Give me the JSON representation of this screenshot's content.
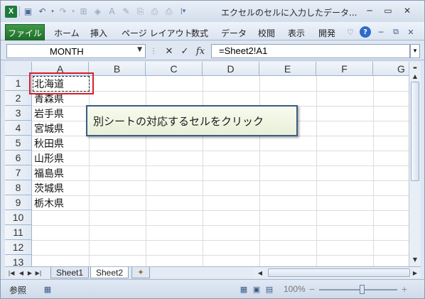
{
  "window": {
    "title": "エクセルのセルに入力したデータ...",
    "min_icon": "minimize-icon",
    "max_icon": "restore-icon",
    "close_icon": "close-icon"
  },
  "quick_access": {
    "app_icon": "X",
    "icons": [
      "save-icon",
      "undo-icon",
      "redo-icon",
      "border-icon",
      "fill-icon",
      "font-color-icon",
      "format-painter-icon",
      "paste-icon",
      "print-preview-icon",
      "print-icon",
      "customize-icon"
    ]
  },
  "ribbon": {
    "file_tab": "ファイル",
    "tabs": [
      "ホーム",
      "挿入",
      "ページ レイアウト",
      "数式",
      "データ",
      "校閲",
      "表示",
      "開発"
    ],
    "right_icons": [
      "minimize-ribbon-icon",
      "help-icon",
      "window-min-icon",
      "window-restore-icon",
      "window-close-icon"
    ]
  },
  "formula_bar": {
    "name_box": "MONTH",
    "cancel": "✕",
    "enter": "✓",
    "fx": "fx",
    "formula": "=Sheet2!A1"
  },
  "grid": {
    "columns": [
      "A",
      "B",
      "C",
      "D",
      "E",
      "F",
      "G"
    ],
    "rows": [
      "1",
      "2",
      "3",
      "4",
      "5",
      "6",
      "7",
      "8",
      "9",
      "10",
      "11",
      "12",
      "13"
    ],
    "cells": [
      "北海道",
      "青森県",
      "岩手県",
      "宮城県",
      "秋田県",
      "山形県",
      "福島県",
      "茨城県",
      "栃木県"
    ]
  },
  "callout": {
    "text": "別シートの対応するセルをクリック"
  },
  "sheet_tabs": {
    "tabs": [
      "Sheet1",
      "Sheet2"
    ],
    "active": "Sheet2",
    "new_sheet_icon": "insert-sheet-icon"
  },
  "status_bar": {
    "mode": "参照",
    "zoom": "100%",
    "zoom_minus": "−",
    "zoom_plus": "+"
  }
}
